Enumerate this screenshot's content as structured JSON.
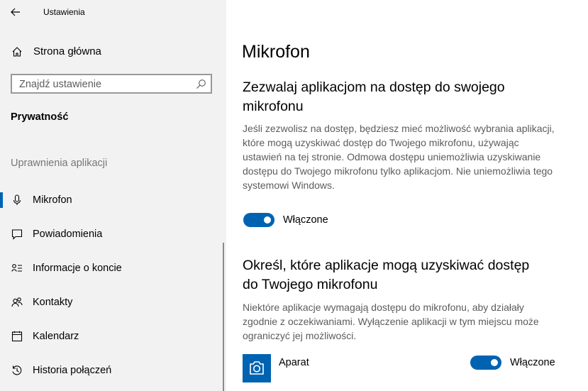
{
  "window": {
    "title": "Ustawienia"
  },
  "sidebar": {
    "home_label": "Strona główna",
    "search_placeholder": "Znajdź ustawienie",
    "section_title": "Prywatność",
    "group_header": "Uprawnienia aplikacji",
    "items": [
      {
        "label": "Mikrofon",
        "icon": "microphone-icon",
        "selected": true
      },
      {
        "label": "Powiadomienia",
        "icon": "notification-icon"
      },
      {
        "label": "Informacje o koncie",
        "icon": "account-info-icon"
      },
      {
        "label": "Kontakty",
        "icon": "contacts-icon"
      },
      {
        "label": "Kalendarz",
        "icon": "calendar-icon"
      },
      {
        "label": "Historia połączeń",
        "icon": "call-history-icon"
      }
    ]
  },
  "main": {
    "title": "Mikrofon",
    "section1": {
      "heading": "Zezwalaj aplikacjom na dostęp do swojego mikrofonu",
      "description": "Jeśli zezwolisz na dostęp, będziesz mieć możliwość wybrania aplikacji, które mogą uzyskiwać dostęp do Twojego mikrofonu, używając ustawień na tej stronie. Odmowa dostępu uniemożliwia uzyskiwanie dostępu do Twojego mikrofonu tylko aplikacjom. Nie uniemożliwia tego systemowi Windows.",
      "toggle_label": "Włączone"
    },
    "section2": {
      "heading": "Określ, które aplikacje mogą uzyskiwać dostęp do Twojego mikrofonu",
      "description": "Niektóre aplikacje wymagają dostępu do mikrofonu, aby działały zgodnie z oczekiwaniami. Wyłączenie aplikacji w tym miejscu może ograniczyć jej możliwości.",
      "apps": [
        {
          "name": "Aparat",
          "toggle_label": "Włączone"
        }
      ]
    }
  },
  "colors": {
    "accent": "#0063b1",
    "sidebar_bg": "#f2f2f2",
    "secondary_text": "#5c5c5c"
  }
}
